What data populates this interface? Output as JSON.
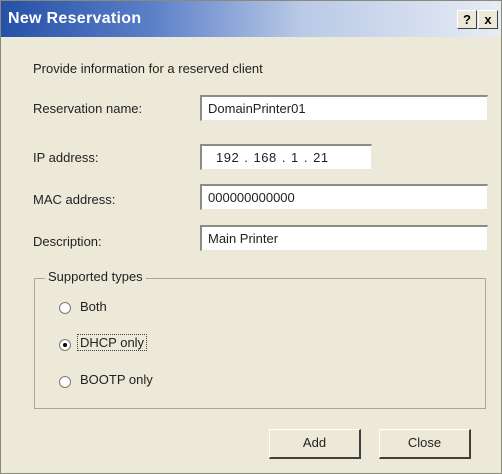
{
  "window": {
    "title": "New Reservation",
    "help_label": "?",
    "close_label": "x"
  },
  "intro_text": "Provide information for a reserved client",
  "fields": {
    "reservation_name": {
      "label": "Reservation name:",
      "value": "DomainPrinter01"
    },
    "ip_address": {
      "label": "IP address:",
      "value": "192 . 168 .  1  .  21"
    },
    "mac_address": {
      "label": "MAC address:",
      "value": "000000000000"
    },
    "description": {
      "label": "Description:",
      "value": "Main Printer"
    }
  },
  "supported_types": {
    "title": "Supported types",
    "options": [
      {
        "label": "Both",
        "selected": false
      },
      {
        "label": "DHCP only",
        "selected": true
      },
      {
        "label": "BOOTP only",
        "selected": false
      }
    ]
  },
  "buttons": {
    "add_label": "Add",
    "close_label": "Close"
  },
  "colors": {
    "dialog_bg": "#ece9d8",
    "title_bar_start": "#2550a8",
    "title_bar_end": "#e7ecf5"
  }
}
